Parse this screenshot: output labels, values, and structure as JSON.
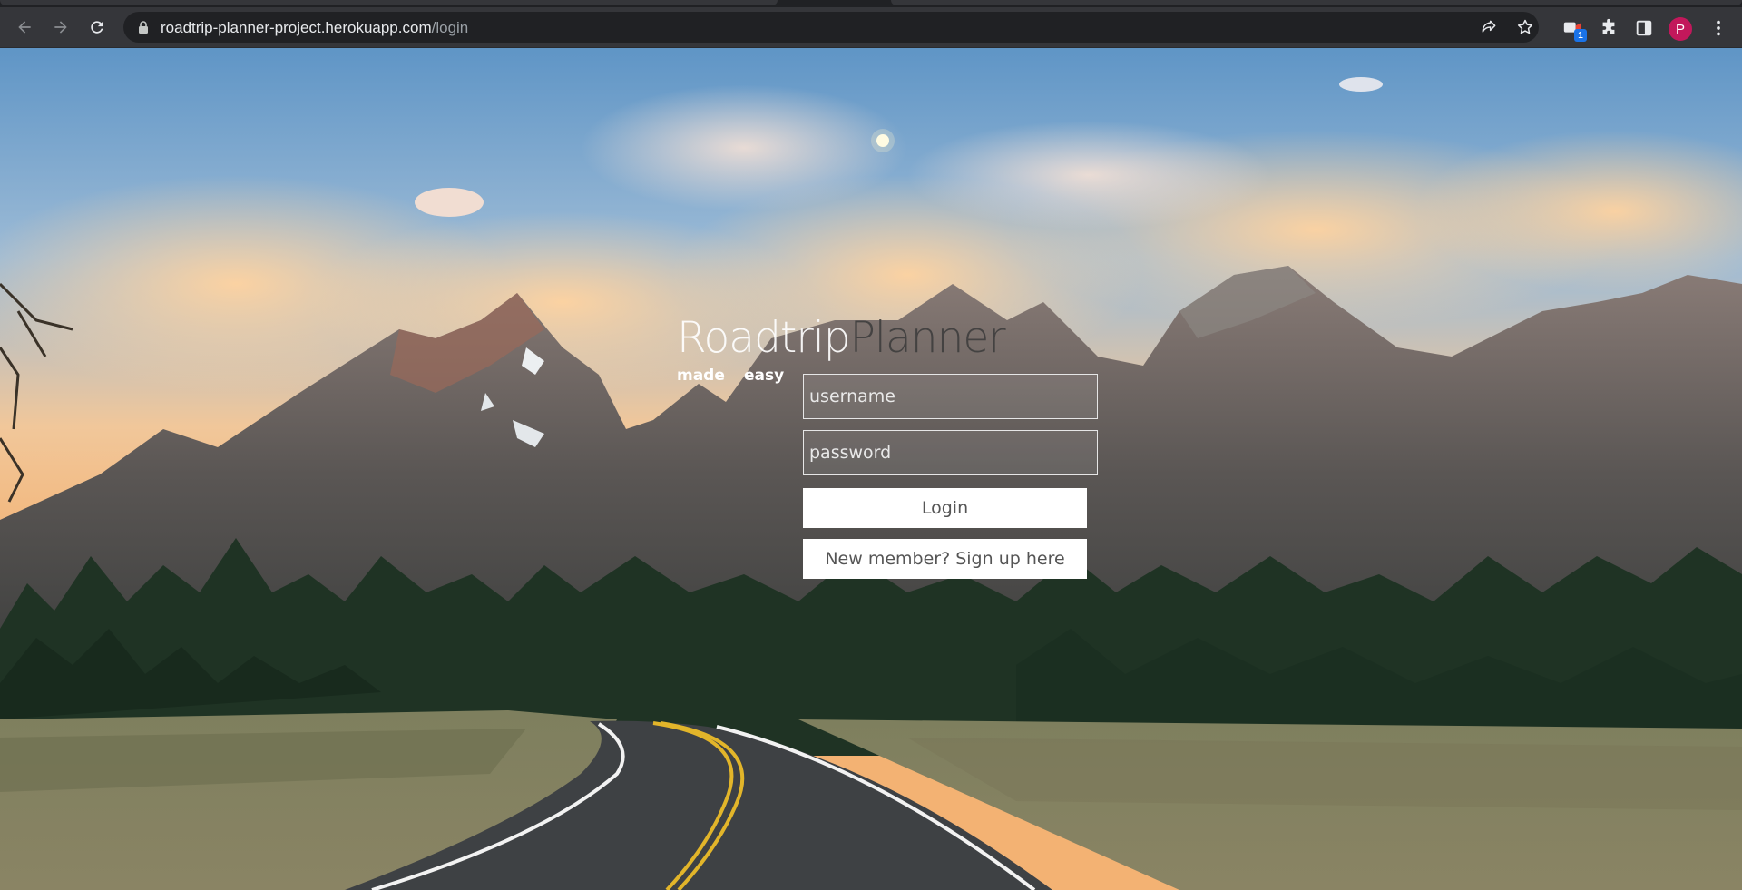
{
  "browser": {
    "url_host": "roadtrip-planner-project.herokuapp.com",
    "url_path": "/login",
    "profile_initial": "P",
    "extension_badge": "1"
  },
  "brand": {
    "part1": "Roadtrip",
    "part2": "Planner",
    "tag_word1": "made",
    "tag_word2": "easy"
  },
  "login_form": {
    "username_placeholder": "username",
    "password_placeholder": "password",
    "login_label": "Login",
    "signup_label": "New member? Sign up here"
  }
}
